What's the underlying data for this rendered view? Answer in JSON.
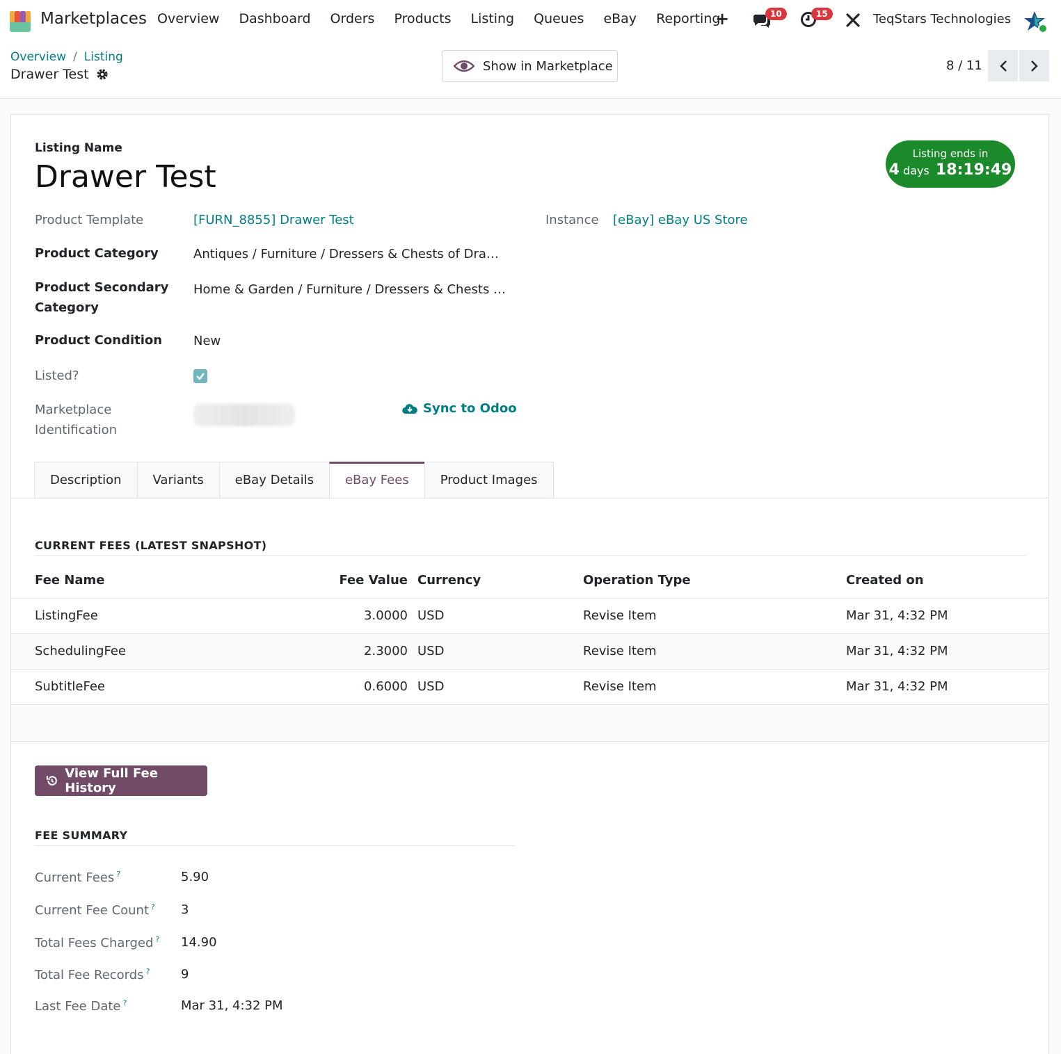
{
  "navbar": {
    "app_name": "Marketplaces",
    "menu": [
      "Overview",
      "Dashboard",
      "Orders",
      "Products",
      "Listing",
      "Queues",
      "eBay",
      "Reporting"
    ],
    "messages_count": "10",
    "activities_count": "15",
    "company": "TeqStars Technologies"
  },
  "control": {
    "breadcrumb": [
      "Overview",
      "Listing"
    ],
    "record_title": "Drawer Test",
    "show_button": "Show in Marketplace",
    "pager": "8 / 11"
  },
  "form": {
    "listing_name_label": "Listing Name",
    "listing_name": "Drawer Test",
    "ends_label": "Listing ends in",
    "ends_days_num": "4",
    "ends_days_unit": "days",
    "ends_time": "18:19:49",
    "fields": {
      "product_template_label": "Product Template",
      "product_template": "[FURN_8855] Drawer Test",
      "instance_label": "Instance",
      "instance": "[eBay] eBay US Store",
      "product_category_label": "Product Category",
      "product_category": "Antiques / Furniture / Dressers & Chests of Dra…",
      "secondary_category_label_1": "Product Secondary",
      "secondary_category_label_2": "Category",
      "secondary_category": "Home & Garden / Furniture / Dressers & Chests …",
      "condition_label": "Product Condition",
      "condition": "New",
      "listed_label": "Listed?",
      "marketplace_id_label_1": "Marketplace",
      "marketplace_id_label_2": "Identification",
      "sync_label": "Sync to Odoo"
    }
  },
  "tabs": [
    "Description",
    "Variants",
    "eBay Details",
    "eBay Fees",
    "Product Images"
  ],
  "current_fees": {
    "title": "CURRENT FEES (LATEST SNAPSHOT)",
    "columns": [
      "Fee Name",
      "Fee Value",
      "Currency",
      "Operation Type",
      "Created on"
    ],
    "rows": [
      [
        "ListingFee",
        "3.0000",
        "USD",
        "Revise Item",
        "Mar 31, 4:32 PM"
      ],
      [
        "SchedulingFee",
        "2.3000",
        "USD",
        "Revise Item",
        "Mar 31, 4:32 PM"
      ],
      [
        "SubtitleFee",
        "0.6000",
        "USD",
        "Revise Item",
        "Mar 31, 4:32 PM"
      ]
    ]
  },
  "history_button": "View Full Fee History",
  "fee_summary": {
    "title": "FEE SUMMARY",
    "items": [
      {
        "label": "Current Fees",
        "value": "5.90"
      },
      {
        "label": "Current Fee Count",
        "value": "3"
      },
      {
        "label": "Total Fees Charged",
        "value": "14.90"
      },
      {
        "label": "Total Fee Records",
        "value": "9"
      },
      {
        "label": "Last Fee Date",
        "value": "Mar 31, 4:32 PM"
      }
    ],
    "help_mark": "?"
  },
  "colors": {
    "accent": "#714b67",
    "link": "#017e84",
    "ends_badge": "#1b8a2a",
    "notification_badge": "#d9363e"
  }
}
